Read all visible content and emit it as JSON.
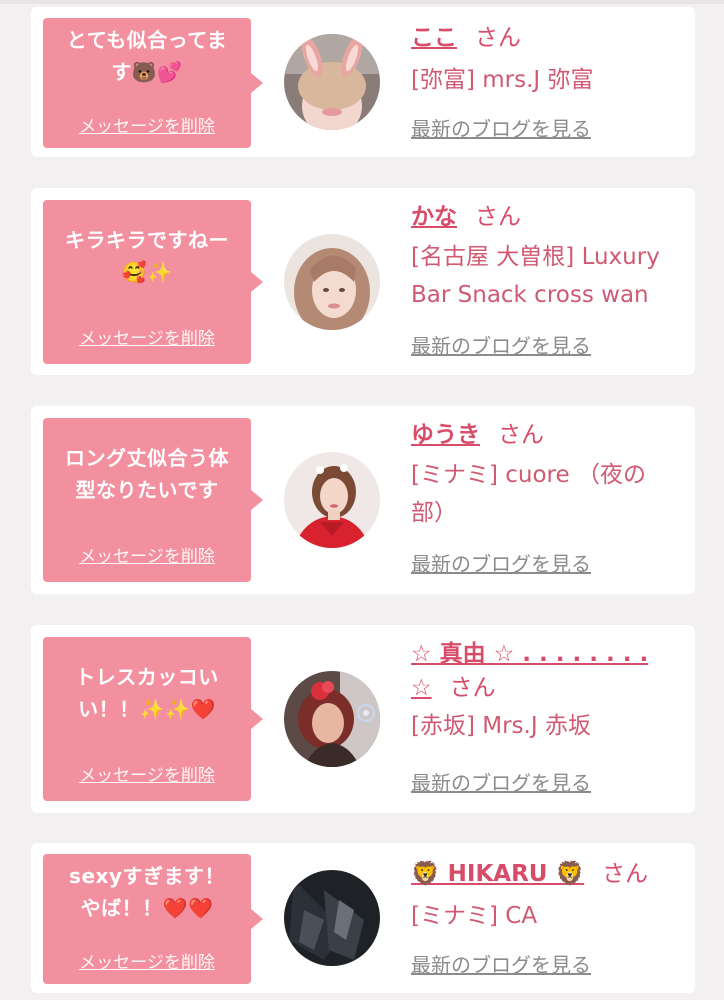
{
  "colors": {
    "page_background": "#f2f0f0",
    "card_background": "#ffffff",
    "bubble_pink": "#f3909f",
    "name_pink": "#d84c69",
    "link_gray": "#8b8b8b"
  },
  "entries": [
    {
      "message_lines": [
        "とても似合ってま",
        "す"
      ],
      "message_emoji": "🐻💕",
      "delete_label": "メッセージを削除",
      "name": "ここ",
      "honorific": "さん",
      "shop_lines": [
        "[弥富] mrs.J 弥富"
      ],
      "blog_link": "最新のブログを見る"
    },
    {
      "message_lines": [
        "キラキラですねー"
      ],
      "message_emoji": "🥰✨",
      "delete_label": "メッセージを削除",
      "name": "かな",
      "honorific": "さん",
      "shop_lines": [
        "[名古屋 大曽根] Luxury",
        "Bar Snack cross wan"
      ],
      "blog_link": "最新のブログを見る"
    },
    {
      "message_lines": [
        "ロング丈似合う体",
        "型なりたいです"
      ],
      "message_emoji": "",
      "delete_label": "メッセージを削除",
      "name": "ゆうき",
      "honorific": "さん",
      "shop_lines": [
        "[ミナミ] cuore （夜の",
        "部）"
      ],
      "blog_link": "最新のブログを見る"
    },
    {
      "message_lines": [
        "トレスカッコい",
        "い！！"
      ],
      "message_emoji": "✨✨❤️",
      "delete_label": "メッセージを削除",
      "name": "☆ 真由 ☆ . . . . . . . .",
      "name_line2": "☆",
      "honorific": "さん",
      "shop_lines": [
        "[赤坂] Mrs.J 赤坂"
      ],
      "blog_link": "最新のブログを見る"
    },
    {
      "message_lines": [
        "sexyすぎます！",
        "やば！！"
      ],
      "message_emoji": "❤️❤️",
      "delete_label": "メッセージを削除",
      "name": "🦁 HIKARU 🦁",
      "honorific": "さん",
      "shop_lines": [
        "[ミナミ] CA"
      ],
      "blog_link": "最新のブログを見る"
    }
  ]
}
